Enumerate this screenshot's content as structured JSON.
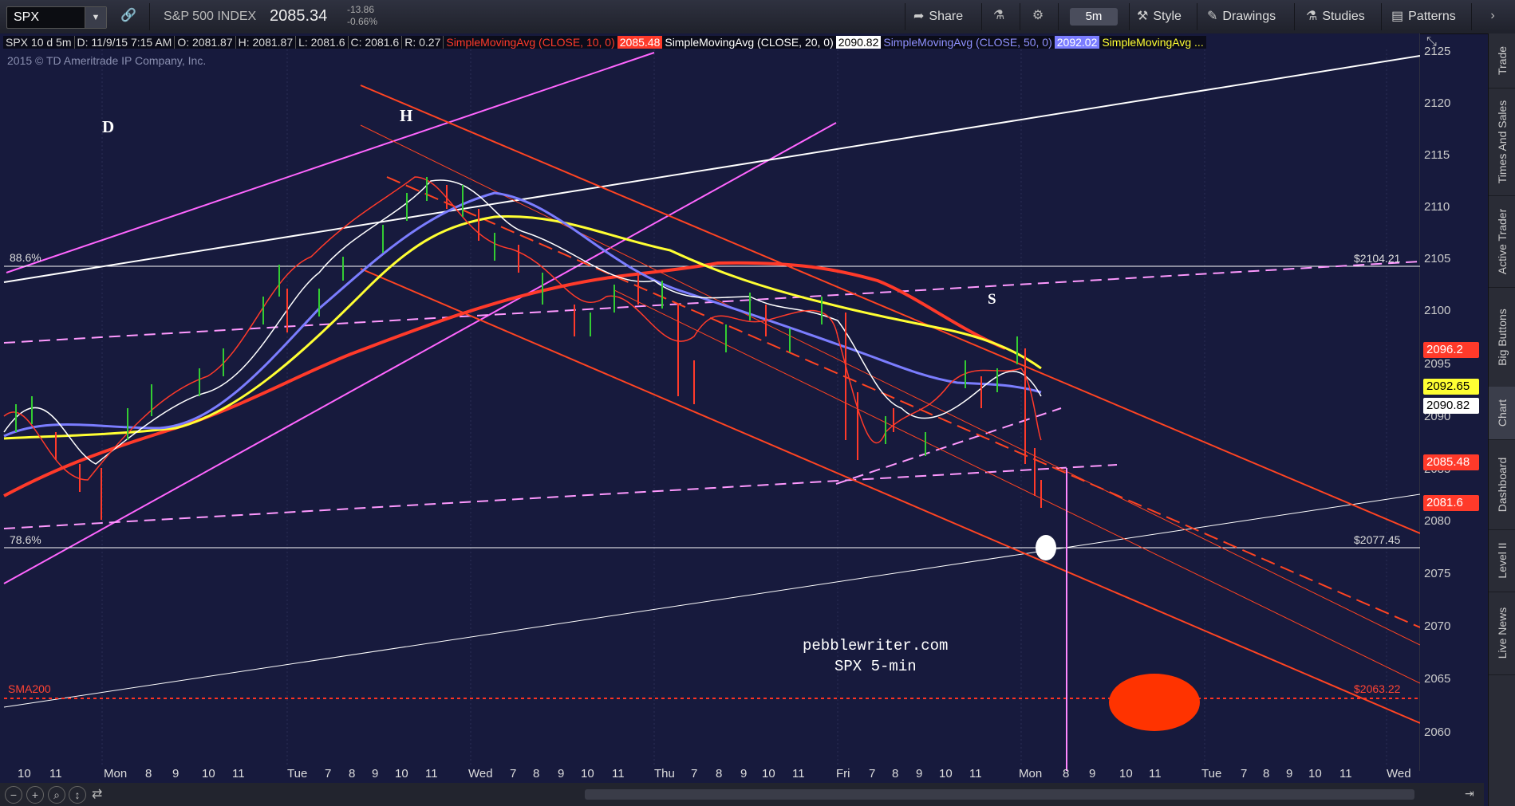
{
  "toolbar": {
    "symbol": "SPX",
    "index_name": "S&P 500 INDEX",
    "price": "2085.34",
    "change": "-13.86",
    "change_pct": "-0.66%",
    "share_label": "Share",
    "timeframe": "5m",
    "style_label": "Style",
    "drawings_label": "Drawings",
    "studies_label": "Studies",
    "patterns_label": "Patterns"
  },
  "study_header": {
    "chart_desc": "SPX 10 d 5m",
    "date": "D: 11/9/15 7:15 AM",
    "open": "O: 2081.87",
    "high": "H: 2081.87",
    "low": "L: 2081.6",
    "close": "C: 2081.6",
    "range": "R: 0.27",
    "sma10_label": "SimpleMovingAvg (CLOSE, 10, 0)",
    "sma10_value": "2085.48",
    "sma20_label": "SimpleMovingAvg (CLOSE, 20, 0)",
    "sma20_value": "2090.82",
    "sma50_label": "SimpleMovingAvg (CLOSE, 50, 0)",
    "sma50_value": "2092.02",
    "sma_more_label": "SimpleMovingAvg ..."
  },
  "copyright": "2015 © TD Ameritrade IP Company, Inc.",
  "annotations": {
    "d": "D",
    "h": "H",
    "s": "S",
    "fib_886": "88.6%",
    "fib_786": "78.6%",
    "sma200": "SMA200",
    "level_2104": "$2104.21",
    "level_2077": "$2077.45",
    "level_2063": "$2063.22",
    "watermark_1": "pebblewriter.com",
    "watermark_2": "SPX 5-min"
  },
  "price_tags": {
    "t1": "2096.2",
    "t2": "2092.65",
    "t3": "2090.82",
    "t4": "2085.48",
    "t5": "2081.6"
  },
  "price_axis": [
    "2125",
    "2120",
    "2115",
    "2110",
    "2105",
    "2100",
    "2095",
    "2090",
    "2085",
    "2080",
    "2075",
    "2070",
    "2065",
    "2060"
  ],
  "time_axis": [
    "10",
    "11",
    "Mon",
    "8",
    "9",
    "10",
    "11",
    "Tue",
    "7",
    "8",
    "9",
    "10",
    "11",
    "Wed",
    "7",
    "8",
    "9",
    "10",
    "11",
    "Thu",
    "7",
    "8",
    "9",
    "10",
    "11",
    "Fri",
    "7",
    "8",
    "9",
    "10",
    "11",
    "Mon",
    "8",
    "9",
    "10",
    "11",
    "Tue",
    "7",
    "8",
    "9",
    "10",
    "11",
    "Wed"
  ],
  "side_tabs": [
    "Trade",
    "Times And Sales",
    "Active Trader",
    "Big Buttons",
    "Chart",
    "Dashboard",
    "Level II",
    "Live News"
  ],
  "chart_data": {
    "type": "line",
    "ylim": [
      2056,
      2125
    ],
    "series": [
      {
        "name": "SimpleMovingAvg (CLOSE, 10, 0)",
        "color": "#ff3a2a"
      },
      {
        "name": "SimpleMovingAvg (CLOSE, 20, 0)",
        "color": "#ffffff"
      },
      {
        "name": "SimpleMovingAvg (CLOSE, 50, 0)",
        "color": "#7b7dff"
      },
      {
        "name": "SimpleMovingAvg ...",
        "color": "#ffff33"
      }
    ],
    "levels": [
      2104.21,
      2077.45,
      2063.22
    ],
    "last_values": [
      2085.48,
      2090.82,
      2092.65,
      2096.2,
      2081.6
    ]
  }
}
